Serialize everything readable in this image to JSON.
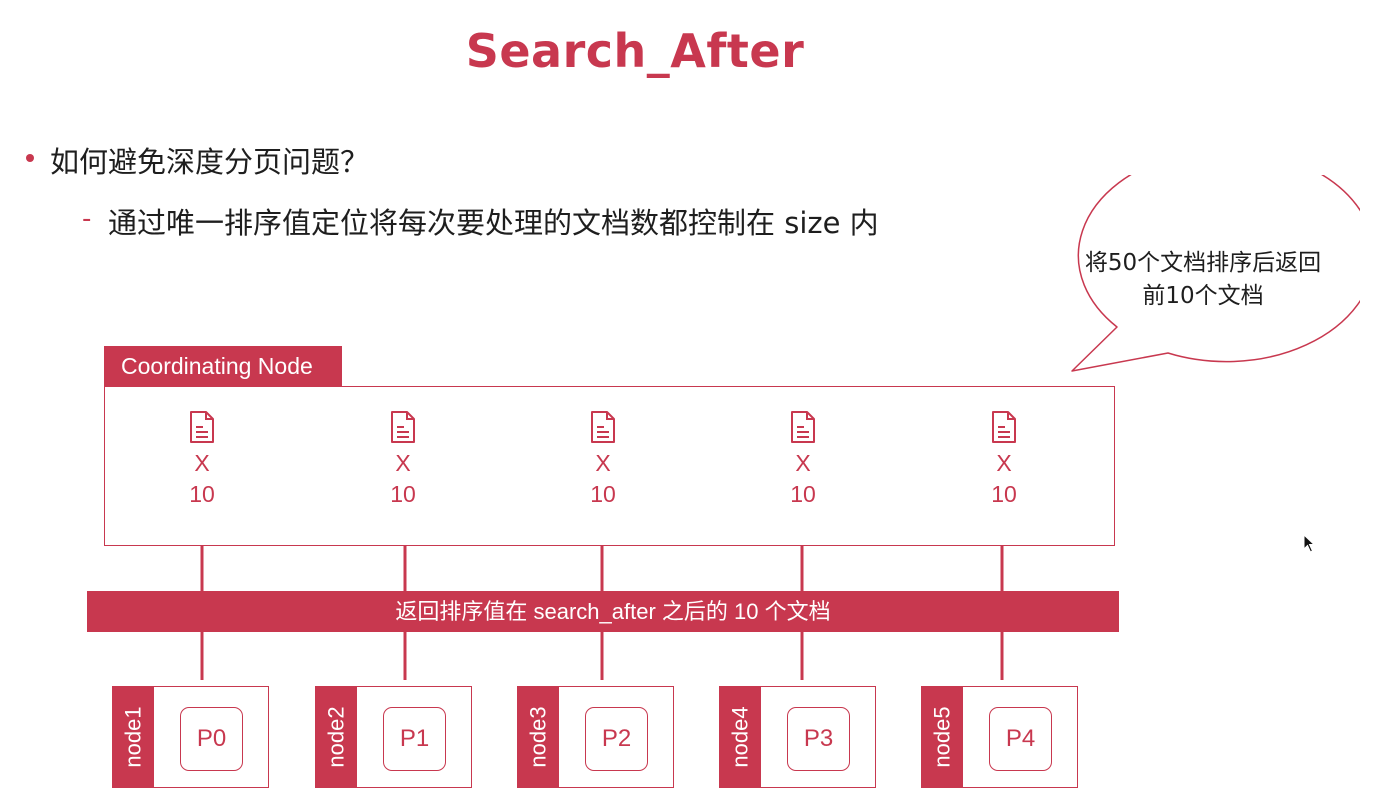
{
  "title": "Search_After",
  "bullet": "如何避免深度分页问题？",
  "sub_bullet": {
    "dash": "-",
    "text": "通过唯一排序值定位将每次要处理的文档数都控制在 size 内"
  },
  "callout": {
    "line1": "将50个文档排序后返回",
    "line2": "前10个文档"
  },
  "coordinating_node": {
    "label": "Coordinating Node",
    "columns": [
      {
        "icon": "document-icon",
        "x": "X",
        "count": "10"
      },
      {
        "icon": "document-icon",
        "x": "X",
        "count": "10"
      },
      {
        "icon": "document-icon",
        "x": "X",
        "count": "10"
      },
      {
        "icon": "document-icon",
        "x": "X",
        "count": "10"
      },
      {
        "icon": "document-icon",
        "x": "X",
        "count": "10"
      }
    ]
  },
  "band_label": "返回排序值在 search_after 之后的 10 个文档",
  "nodes": [
    {
      "label": "node1",
      "shard": "P0"
    },
    {
      "label": "node2",
      "shard": "P1"
    },
    {
      "label": "node3",
      "shard": "P2"
    },
    {
      "label": "node4",
      "shard": "P3"
    },
    {
      "label": "node5",
      "shard": "P4"
    }
  ],
  "colors": {
    "accent": "#c8384f",
    "text": "#1e1e1e",
    "background": "#ffffff"
  }
}
